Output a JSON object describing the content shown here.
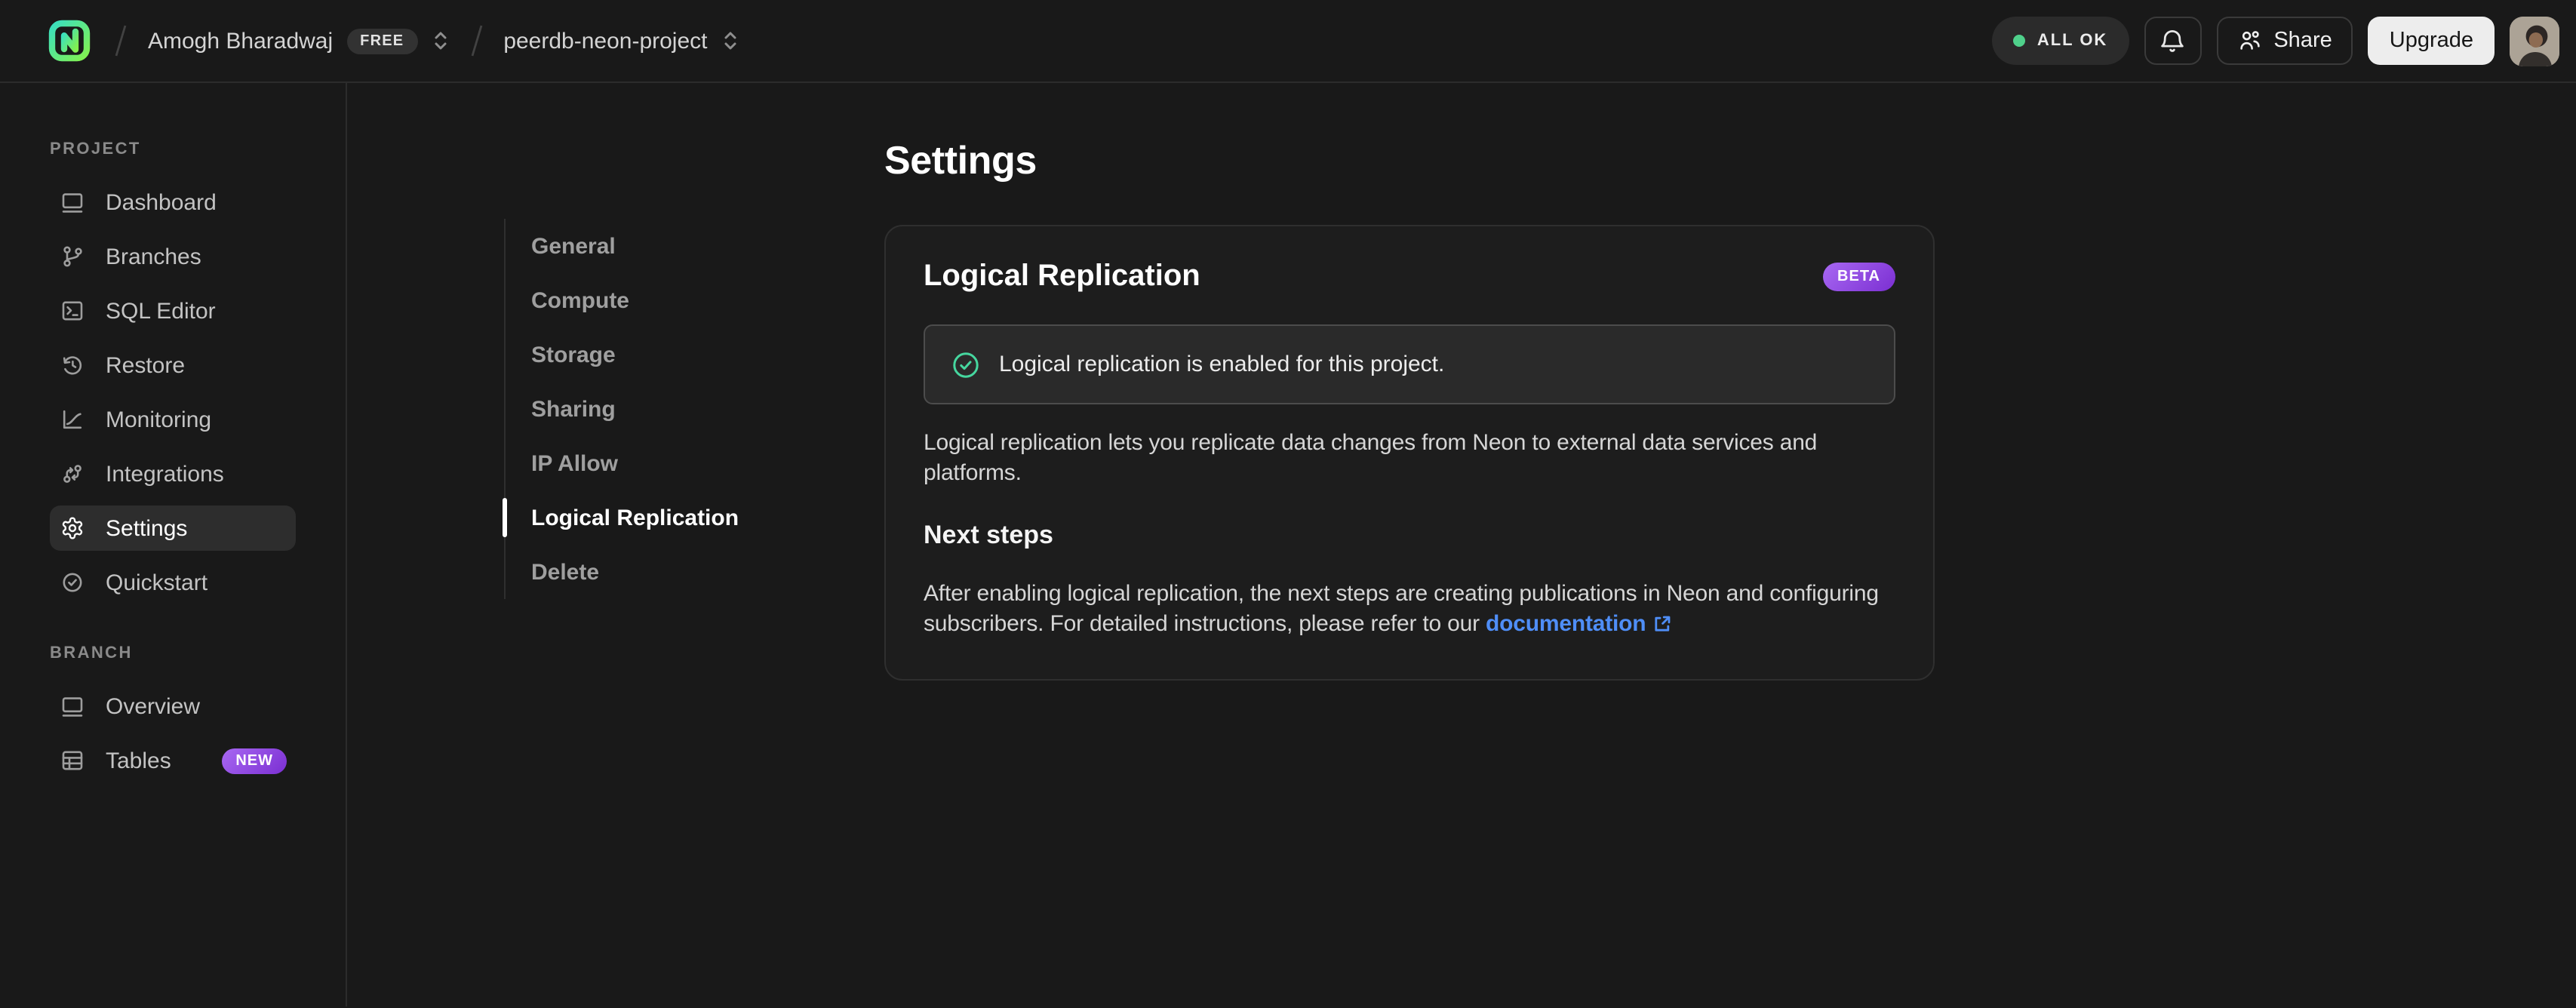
{
  "header": {
    "account": {
      "name": "Amogh Bharadwaj",
      "plan_badge": "FREE"
    },
    "project": {
      "name": "peerdb-neon-project"
    },
    "status_badge": "ALL OK",
    "share_button": "Share",
    "upgrade_button": "Upgrade"
  },
  "sidebar": {
    "sections": [
      {
        "label": "PROJECT",
        "items": [
          {
            "label": "Dashboard",
            "icon": "dashboard-icon",
            "active": false
          },
          {
            "label": "Branches",
            "icon": "git-branch-icon",
            "active": false
          },
          {
            "label": "SQL Editor",
            "icon": "sql-editor-icon",
            "active": false
          },
          {
            "label": "Restore",
            "icon": "restore-icon",
            "active": false
          },
          {
            "label": "Monitoring",
            "icon": "monitoring-icon",
            "active": false
          },
          {
            "label": "Integrations",
            "icon": "integrations-icon",
            "active": false
          },
          {
            "label": "Settings",
            "icon": "gear-icon",
            "active": true
          },
          {
            "label": "Quickstart",
            "icon": "check-circle-icon",
            "active": false
          }
        ]
      },
      {
        "label": "BRANCH",
        "items": [
          {
            "label": "Overview",
            "icon": "window-icon",
            "active": false
          },
          {
            "label": "Tables",
            "icon": "table-icon",
            "active": false,
            "badge": "NEW"
          }
        ]
      }
    ]
  },
  "settings_nav": {
    "items": [
      {
        "label": "General",
        "active": false
      },
      {
        "label": "Compute",
        "active": false
      },
      {
        "label": "Storage",
        "active": false
      },
      {
        "label": "Sharing",
        "active": false
      },
      {
        "label": "IP Allow",
        "active": false
      },
      {
        "label": "Logical Replication",
        "active": true
      },
      {
        "label": "Delete",
        "active": false
      }
    ]
  },
  "main": {
    "page_title": "Settings",
    "card": {
      "title": "Logical Replication",
      "beta_badge": "BETA",
      "success_banner": "Logical replication is enabled for this project.",
      "description": "Logical replication lets you replicate data changes from Neon to external data services and platforms.",
      "next_steps": {
        "title": "Next steps",
        "text": "After enabling logical replication, the next steps are creating publications in Neon and configuring subscribers. For detailed instructions, please refer to our ",
        "link_label": "documentation"
      }
    }
  },
  "colors": {
    "status_green": "#4fd18b",
    "success_green": "#46d79f",
    "badge_purple_start": "#a868f2",
    "badge_purple_end": "#7b2fd2",
    "link_blue": "#4f8ef7",
    "logo_teal": "#39dfc0",
    "logo_green": "#83f14e"
  }
}
